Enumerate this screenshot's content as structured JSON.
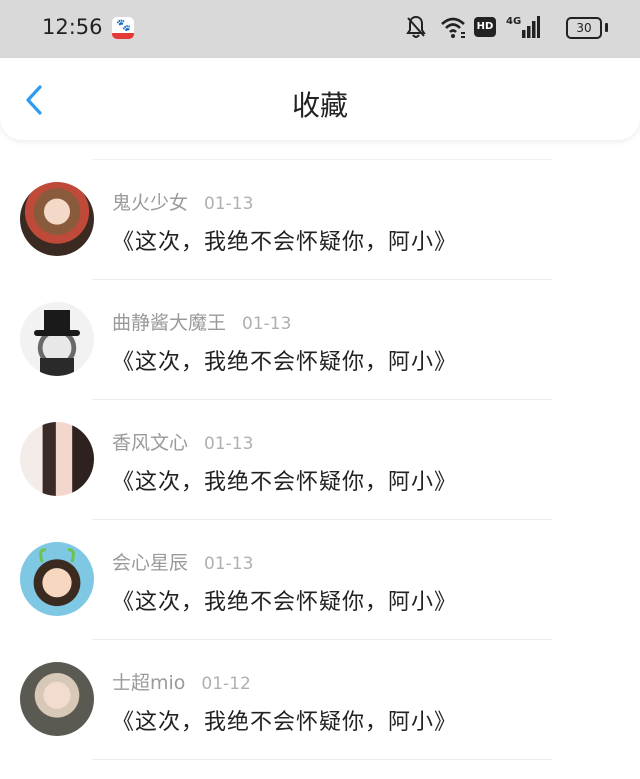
{
  "status_bar": {
    "time": "12:56",
    "app_icon": "baidu-app-icon",
    "hd_label": "HD",
    "network_label": "4G",
    "battery_level": "30",
    "icons": [
      "bell-muted-icon",
      "wifi-icon",
      "hd-icon",
      "signal-icon",
      "battery-icon"
    ]
  },
  "header": {
    "back_icon": "chevron-left-icon",
    "title": "收藏"
  },
  "colors": {
    "accent": "#2b9cf2",
    "status_bar_bg": "#d9d9d9",
    "name_gray": "#9a9a9a"
  },
  "items": [
    {
      "username": "鬼火少女",
      "date": "01-13",
      "content": "《这次，我绝不会怀疑你，阿小》",
      "avatar": "anime-girl-avatar"
    },
    {
      "username": "曲静酱大魔王",
      "date": "01-13",
      "content": "《这次，我绝不会怀疑你，阿小》",
      "avatar": "top-hat-avatar"
    },
    {
      "username": "香风文心",
      "date": "01-13",
      "content": "《这次，我绝不会怀疑你，阿小》",
      "avatar": "girl-photo-avatar"
    },
    {
      "username": "会心星辰",
      "date": "01-13",
      "content": "《这次，我绝不会怀疑你，阿小》",
      "avatar": "child-avatar"
    },
    {
      "username": "士超mio",
      "date": "01-12",
      "content": "《这次，我绝不会怀疑你，阿小》",
      "avatar": "boy-photo-avatar"
    }
  ]
}
